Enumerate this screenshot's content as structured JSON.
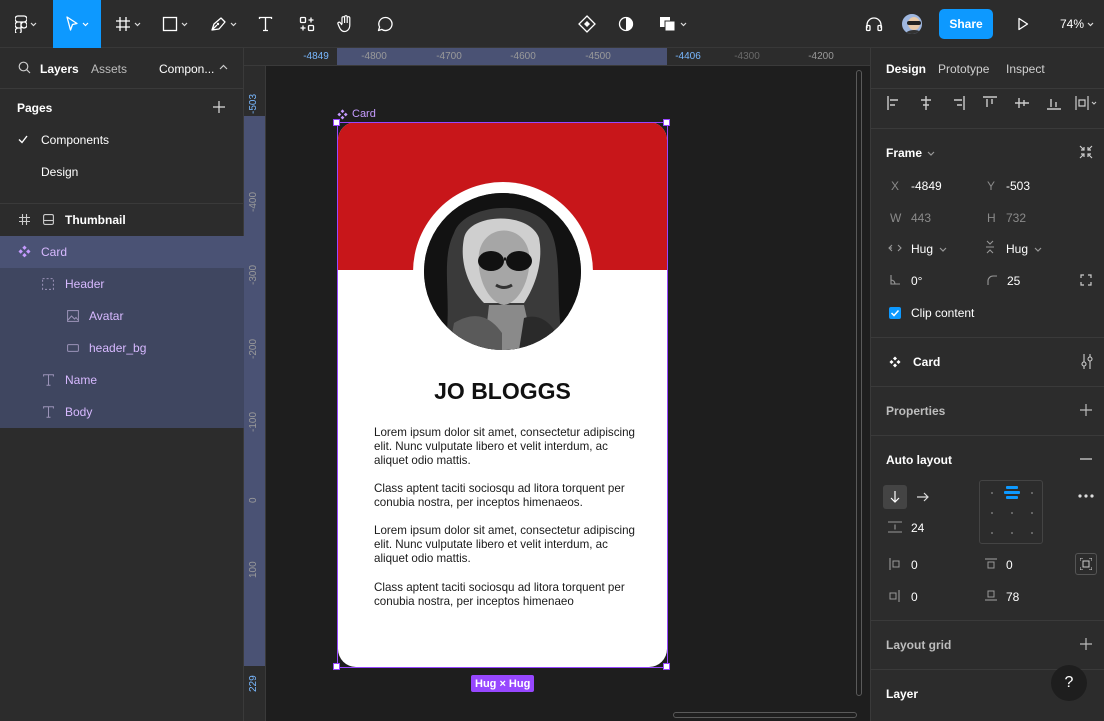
{
  "toolbar": {
    "share_label": "Share",
    "zoom": "74%"
  },
  "left_panel": {
    "tabs": [
      "Layers",
      "Assets"
    ],
    "page_selector": "Compon...",
    "pages_title": "Pages",
    "pages": [
      "Components",
      "Design"
    ],
    "layers": {
      "thumbnail": "Thumbnail",
      "card": "Card",
      "header": "Header",
      "avatar": "Avatar",
      "header_bg": "header_bg",
      "name": "Name",
      "body": "Body"
    }
  },
  "ruler_top": {
    "sel_start": "-4849",
    "sel_end": "-4406",
    "ticks": [
      "-4800",
      "-4700",
      "-4600",
      "-4500",
      "-4300",
      "-4200"
    ]
  },
  "ruler_left": {
    "sel_start": "-503",
    "sel_end": "229",
    "ticks": [
      "-400",
      "-300",
      "-200",
      "-100",
      "0",
      "100"
    ]
  },
  "canvas": {
    "frame_label": "Card",
    "size_badge": "Hug × Hug",
    "card": {
      "name": "JO BLOGGS",
      "paragraphs": [
        "Lorem ipsum dolor sit amet, consectetur adipiscing elit. Nunc vulputate libero et velit interdum, ac aliquet odio mattis.",
        "Class aptent taciti sociosqu ad litora torquent per conubia nostra, per inceptos himenaeos.",
        "Lorem ipsum dolor sit amet, consectetur adipiscing elit. Nunc vulputate libero et velit interdum, ac aliquet odio mattis.",
        "Class aptent taciti sociosqu ad litora torquent per conubia nostra, per inceptos himenaeo"
      ]
    }
  },
  "right_panel": {
    "tabs": [
      "Design",
      "Prototype",
      "Inspect"
    ],
    "frame": {
      "title": "Frame",
      "x_label": "X",
      "x": "-4849",
      "y_label": "Y",
      "y": "-503",
      "w_label": "W",
      "w": "443",
      "h_label": "H",
      "h": "732",
      "hug_h": "Hug",
      "hug_v": "Hug",
      "rotation": "0°",
      "radius": "25",
      "clip_content": "Clip content"
    },
    "component_name": "Card",
    "properties": "Properties",
    "auto_layout": {
      "title": "Auto layout",
      "spacing": "24",
      "padding_left": "0",
      "padding_top": "0",
      "padding_right": "0",
      "padding_bottom": "78"
    },
    "layout_grid": "Layout grid",
    "layer": "Layer",
    "help": "?"
  },
  "colors": {
    "accent_blue": "#0d99ff",
    "component_purple": "#9747ff",
    "card_red": "#c8161a",
    "selection_bg": "#4a5274"
  }
}
